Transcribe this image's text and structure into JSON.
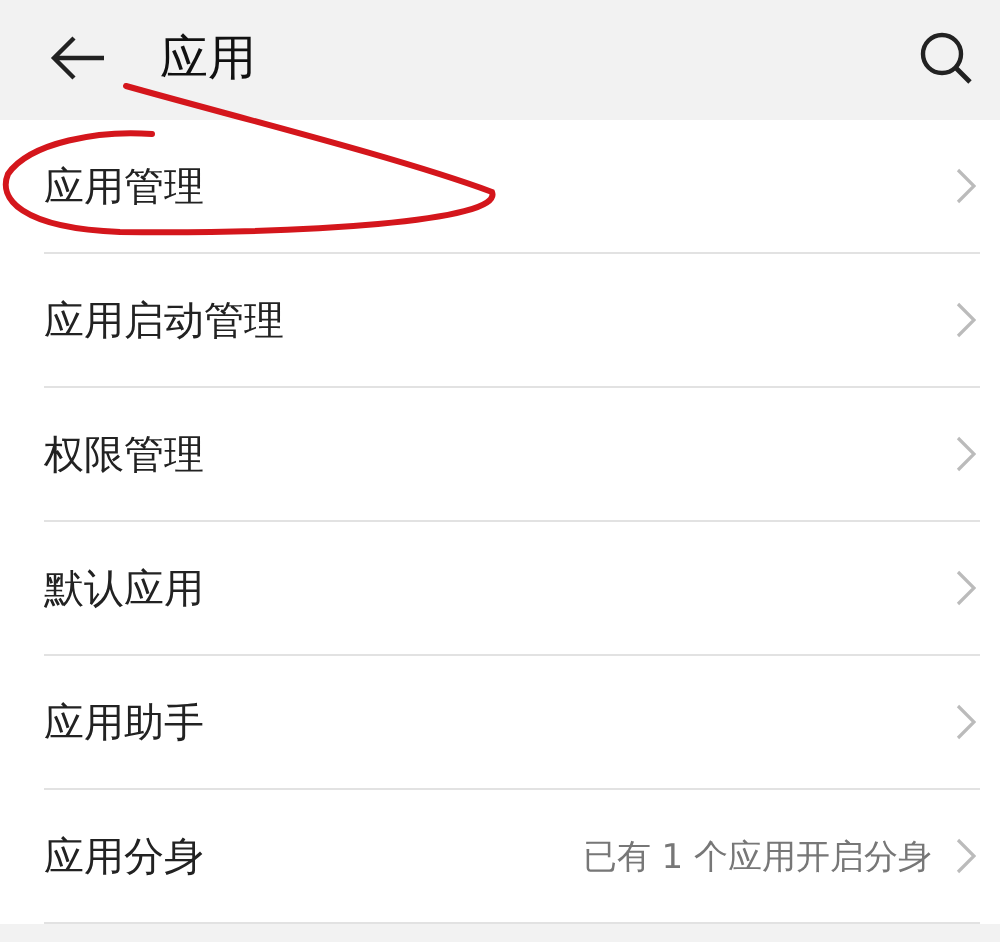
{
  "header": {
    "title": "应用"
  },
  "items": [
    {
      "label": "应用管理",
      "circled": true
    },
    {
      "label": "应用启动管理",
      "circled": false
    },
    {
      "label": "权限管理",
      "circled": false
    },
    {
      "label": "默认应用",
      "circled": false
    },
    {
      "label": "应用助手",
      "circled": false
    },
    {
      "label": "应用分身",
      "value": "已有 1 个应用开启分身",
      "circled": false
    }
  ]
}
